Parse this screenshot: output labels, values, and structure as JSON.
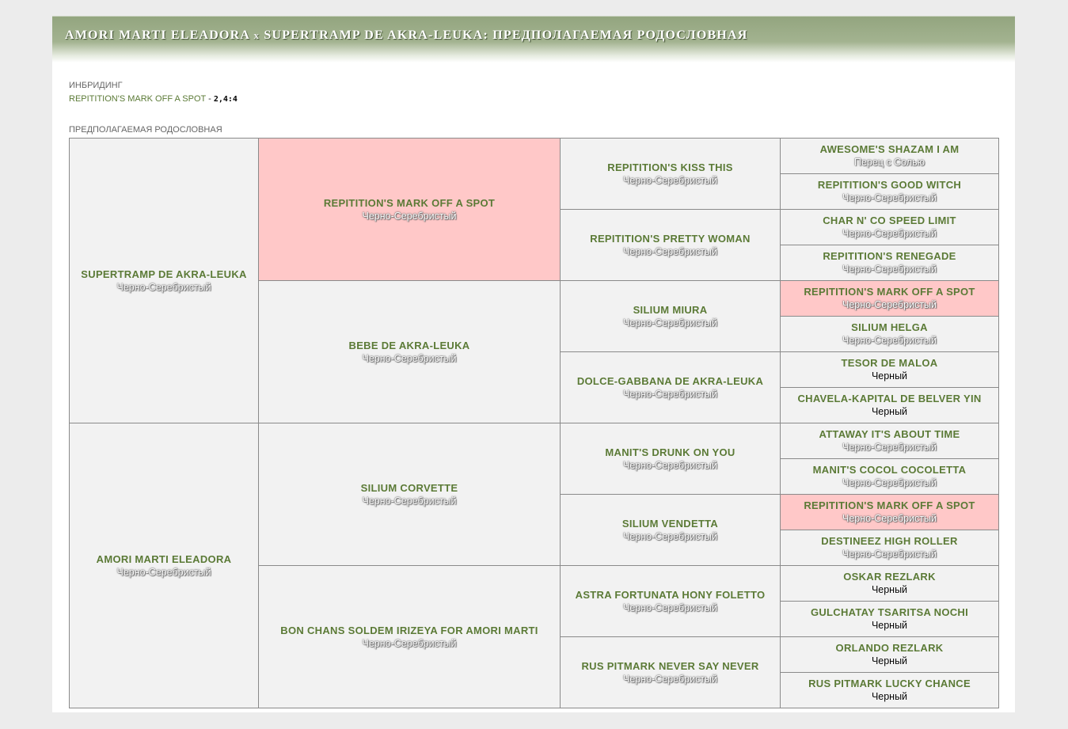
{
  "header": {
    "mare": "AMORI MARTI ELEADORA",
    "separator": "x",
    "stallion": "SUPERTRAMP DE AKRA-LEUKA",
    "suffix": ": ПРЕДПОЛАГАЕМАЯ РОДОСЛОВНАЯ"
  },
  "inbreeding": {
    "label": "ИНБРИДИНГ",
    "horse": "REPITITION'S MARK OFF A SPOT",
    "dash": " - ",
    "generations": "2,4:4"
  },
  "pedigree_label": "ПРЕДПОЛАГАЕМАЯ РОДОСЛОВНАЯ",
  "pedigree": {
    "g1": [
      {
        "name": "SUPERTRAMP DE AKRA-LEUKA",
        "color": "Черно-Серебристый"
      },
      {
        "name": "AMORI MARTI ELEADORA",
        "color": "Черно-Серебристый"
      }
    ],
    "g2": [
      {
        "name": "REPITITION'S MARK OFF A SPOT",
        "color": "Черно-Серебристый"
      },
      {
        "name": "BEBE DE AKRA-LEUKA",
        "color": "Черно-Серебристый"
      },
      {
        "name": "SILIUM CORVETTE",
        "color": "Черно-Серебристый"
      },
      {
        "name": "BON CHANS SOLDEM IRIZEYA FOR AMORI MARTI",
        "color": "Черно-Серебристый"
      }
    ],
    "g3": [
      {
        "name": "REPITITION'S KISS THIS",
        "color": "Черно-Серебристый"
      },
      {
        "name": "REPITITION'S PRETTY WOMAN",
        "color": "Черно-Серебристый"
      },
      {
        "name": "SILIUM MIURA",
        "color": "Черно-Серебристый"
      },
      {
        "name": "DOLCE-GABBANA DE AKRA-LEUKA",
        "color": "Черно-Серебристый"
      },
      {
        "name": "MANIT'S DRUNK ON YOU",
        "color": "Черно-Серебристый"
      },
      {
        "name": "SILIUM VENDETTA",
        "color": "Черно-Серебристый"
      },
      {
        "name": "ASTRA FORTUNATA HONY FOLETTO",
        "color": "Черно-Серебристый"
      },
      {
        "name": "RUS PITMARK NEVER SAY NEVER",
        "color": "Черно-Серебристый"
      }
    ],
    "g4": [
      {
        "name": "AWESOME'S SHAZAM I AM",
        "color": "Перец с Солью"
      },
      {
        "name": "REPITITION'S GOOD WITCH",
        "color": "Черно-Серебристый"
      },
      {
        "name": "CHAR N' CO SPEED LIMIT",
        "color": "Черно-Серебристый"
      },
      {
        "name": "REPITITION'S RENEGADE",
        "color": "Черно-Серебристый"
      },
      {
        "name": "REPITITION'S MARK OFF A SPOT",
        "color": "Черно-Серебристый"
      },
      {
        "name": "SILIUM HELGA",
        "color": "Черно-Серебристый"
      },
      {
        "name": "TESOR DE MALOA",
        "color": "Черный"
      },
      {
        "name": "CHAVELA-KAPITAL DE BELVER YIN",
        "color": "Черный"
      },
      {
        "name": "ATTAWAY IT'S ABOUT TIME",
        "color": "Черно-Серебристый"
      },
      {
        "name": "MANIT'S COCOL COCOLETTA",
        "color": "Черно-Серебристый"
      },
      {
        "name": "REPITITION'S MARK OFF A SPOT",
        "color": "Черно-Серебристый"
      },
      {
        "name": "DESTINEEZ HIGH ROLLER",
        "color": "Черно-Серебристый"
      },
      {
        "name": "OSKAR REZLARK",
        "color": "Черный"
      },
      {
        "name": "GULCHATAY TSARITSA NOCHI",
        "color": "Черный"
      },
      {
        "name": "ORLANDO REZLARK",
        "color": "Черный"
      },
      {
        "name": "RUS PITMARK LUCKY CHANCE",
        "color": "Черный"
      }
    ]
  },
  "colors": {
    "highlight": "#ffc8c8",
    "cell_bg": "#f2f2f2",
    "name_green": "#5b7a36"
  }
}
